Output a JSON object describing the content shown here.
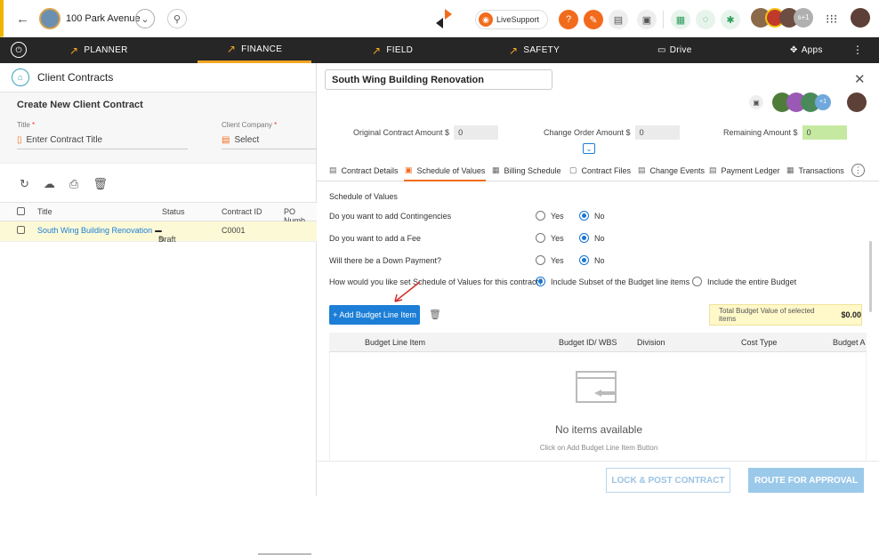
{
  "topbar": {
    "project_name": "100 Park Avenue",
    "livesupport_label": "LiveSupport"
  },
  "nav": {
    "items": [
      {
        "label": "PLANNER"
      },
      {
        "label": "FINANCE"
      },
      {
        "label": "FIELD"
      },
      {
        "label": "SAFETY"
      },
      {
        "label": "Drive"
      },
      {
        "label": "Apps"
      }
    ],
    "active": "FINANCE"
  },
  "left": {
    "title": "Client Contracts",
    "form": {
      "heading": "Create New Client Contract",
      "title_label": "Title",
      "company_label": "Client Company",
      "title_placeholder": "Enter Contract Title",
      "company_placeholder": "Select"
    },
    "table": {
      "headers": [
        "Title",
        "Status",
        "Contract ID",
        "PO Numb"
      ],
      "rows": [
        {
          "title": "South Wing Building Renovation",
          "status": "Draft",
          "contract_id": "C0001"
        }
      ]
    }
  },
  "right": {
    "project_title": "South Wing Building Renovation",
    "amounts": {
      "original_label": "Original Contract Amount $",
      "original_value": "0",
      "change_label": "Change Order Amount $",
      "change_value": "0",
      "remaining_label": "Remaining Amount $",
      "remaining_value": "0"
    },
    "tabs": [
      "Contract Details",
      "Schedule of Values",
      "Billing Schedule",
      "Contract Files",
      "Change Events",
      "Payment Ledger",
      "Transactions"
    ],
    "active_tab": "Schedule of Values",
    "section_title": "Schedule of Values",
    "questions": [
      {
        "text": "Do you want to add Contingencies",
        "yes": "Yes",
        "no": "No",
        "selected": "No"
      },
      {
        "text": "Do you want to add a Fee",
        "yes": "Yes",
        "no": "No",
        "selected": "No"
      },
      {
        "text": "Will there be a Down Payment?",
        "yes": "Yes",
        "no": "No",
        "selected": "No"
      }
    ],
    "sov_question": "How would you like set Schedule of Values for this contract?",
    "sov_option1": "Include Subset of the Budget line items",
    "sov_option2": "Include the entire Budget",
    "add_button": "+ Add Budget Line Item",
    "total_label": "Total Budget Value of selected items",
    "total_value": "$0.00",
    "grid_headers": [
      "Budget Line Item",
      "Budget ID/ WBS",
      "Division",
      "Cost Type",
      "Budget A"
    ],
    "empty_title": "No items available",
    "empty_hint": "Click on Add Budget Line Item Button",
    "lock_button": "LOCK & POST CONTRACT",
    "route_button": "ROUTE FOR APPROVAL"
  },
  "colors": {
    "accent": "#f26b1d",
    "primary": "#1c7ed6",
    "nav_bg": "#262626"
  }
}
